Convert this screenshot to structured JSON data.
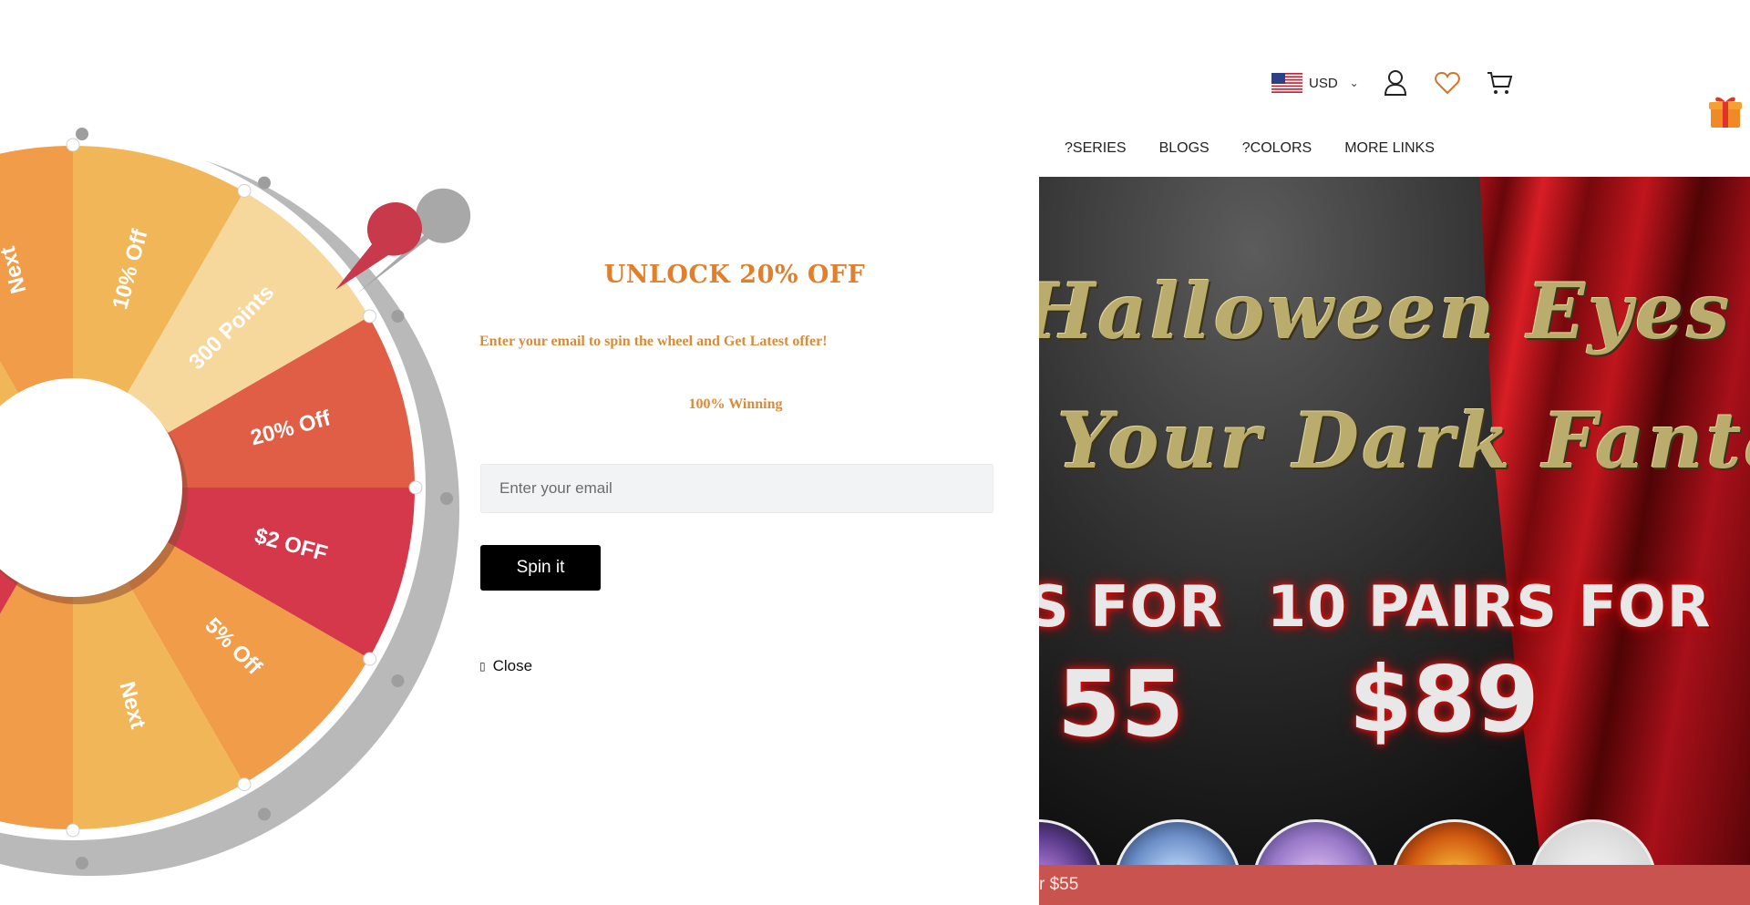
{
  "header": {
    "currency": "USD",
    "nav": [
      "?SERIES",
      "BLOGS",
      "?COLORS",
      "MORE LINKS"
    ]
  },
  "hero": {
    "line1": "Halloween Eyes",
    "line2": "Your Dark Fantasy",
    "offer_left_line1": "S FOR",
    "offer_left_line2": "55",
    "offer_right_line1": "10 PAIRS FOR",
    "offer_right_line2": "$89"
  },
  "promo_bar": {
    "text": "r $55"
  },
  "popup": {
    "title": "UNLOCK 20% OFF",
    "subtitle": "Enter your email to spin the wheel and Get Latest offer!",
    "winning": "100% Winning",
    "email_placeholder": "Enter your email",
    "spin_label": "Spin it",
    "close_label": "Close",
    "wheel_segments": [
      {
        "label": "10% Off",
        "color": "#f0b657"
      },
      {
        "label": "300 Points",
        "color": "#f6d79c"
      },
      {
        "label": "20% Off",
        "color": "#df5e45"
      },
      {
        "label": "$2 OFF",
        "color": "#d5384b"
      },
      {
        "label": "5% Off",
        "color": "#f09c48"
      },
      {
        "label": "Next",
        "color": "#f0b657"
      },
      {
        "label": "",
        "color": "#f09c48"
      },
      {
        "label": "",
        "color": "#d5384b"
      },
      {
        "label": "",
        "color": "#df5e45"
      },
      {
        "label": "",
        "color": "#f6d79c"
      },
      {
        "label": "",
        "color": "#f0b657"
      },
      {
        "label": "Next",
        "color": "#f09c48"
      }
    ]
  },
  "colors": {
    "accent_orange": "#e07f2c",
    "pointer": "#c83a4b",
    "promo_bar": "#c9534f"
  }
}
